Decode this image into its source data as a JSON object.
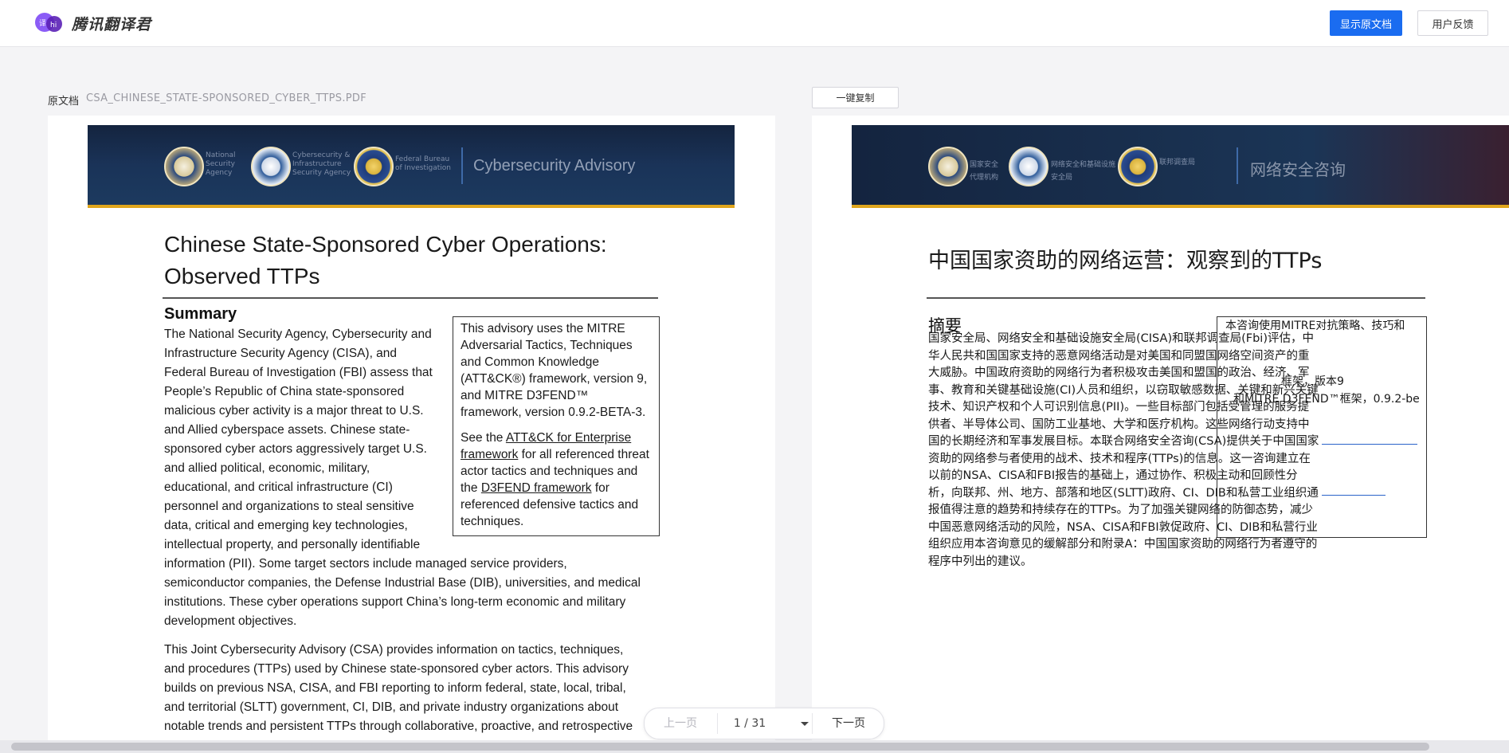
{
  "app": {
    "logo_badge": "hi",
    "logo_text": "腾讯翻译君"
  },
  "header": {
    "show_original_label": "显示原文档",
    "feedback_label": "用户反馈"
  },
  "file_bar": {
    "label": "原文档",
    "file_name": "CSA_CHINESE_STATE-SPONSORED_CYBER_TTPS.PDF",
    "copy_all_label": "一键复制"
  },
  "original": {
    "banner": {
      "agency1": "National\nSecurity\nAgency",
      "agency2": "Cybersecurity &\nInfrastructure\nSecurity Agency",
      "agency3": "Federal Bureau\nof Investigation",
      "title": "Cybersecurity Advisory"
    },
    "title": "Chinese State-Sponsored Cyber Operations: Observed TTPs",
    "summary_heading": "Summary",
    "para1_lines": [
      "The National Security Agency, Cybersecurity and",
      "Infrastructure Security Agency (CISA), and",
      "Federal Bureau of Investigation (FBI) assess that",
      "People’s Republic of China state-sponsored",
      "malicious cyber activity is a major threat to U.S.",
      "and Allied cyberspace assets. Chinese state-",
      "sponsored cyber actors aggressively target U.S.",
      "and allied political, economic, military,",
      "educational, and critical infrastructure (CI)",
      "personnel and organizations to steal sensitive",
      "data, critical and emerging key technologies,",
      "intellectual property, and personally identifiable",
      "information (PII). Some target sectors include managed service providers,",
      "semiconductor companies, the Defense Industrial Base (DIB), universities, and medical",
      "institutions. These cyber operations support China’s long-term economic and military",
      "development objectives."
    ],
    "para2_lines": [
      "This Joint Cybersecurity Advisory (CSA) provides information on tactics, techniques,",
      "and procedures (TTPs) used by Chinese state-sponsored cyber actors. This advisory",
      "builds on previous NSA, CISA, and FBI reporting to inform federal, state, local, tribal,",
      "and territorial (SLTT) government, CI, DIB, and private industry organizations about",
      "notable trends and persistent TTPs through collaborative, proactive, and retrospective"
    ],
    "sidebar": {
      "p1": "This advisory uses the MITRE Adversarial Tactics, Techniques and Common Knowledge (ATT&CK®) framework, version 9, and MITRE D3FEND™ framework, version 0.9.2-BETA-3.",
      "p2_pre": "See the ",
      "p2_link1": "ATT&CK for Enterprise framework",
      "p2_mid": " for all referenced threat actor tactics and techniques and the ",
      "p2_link2": "D3FEND framework",
      "p2_post": " for referenced defensive tactics and techniques."
    }
  },
  "translated": {
    "banner": {
      "agency1": "国家安全\n代理机构",
      "agency2": "网络安全和基础设施\n安全局",
      "agency3": "联邦调查局",
      "title": "网络安全咨询"
    },
    "title": "中国国家资助的网络运营：观察到的TTPs",
    "summary_heading": "摘要",
    "para_lines": [
      "国家安全局、网络安全和基础设施安全局(CISA)和联邦调查局(Fbi)评估，中",
      "华人民共和国国家支持的恶意网络活动是对美国和同盟国网络空间资产的重",
      "大威胁。中国政府资助的网络行为者积极攻击美国和盟国的政治、经济、军",
      "事、教育和关键基础设施(CI)人员和组织，以窃取敏感数据、关键和新兴关键",
      "技术、知识产权和个人可识别信息(PII)。一些目标部门包括受管理的服务提",
      "供者、半导体公司、国防工业基地、大学和医疗机构。这些网络行动支持中",
      "国的长期经济和军事发展目标。本联合网络安全咨询(CSA)提供关于中国国家",
      "资助的网络参与者使用的战术、技术和程序(TTPs)的信息。这一咨询建立在",
      "以前的NSA、CISA和FBI报告的基础上，通过协作、积极主动和回顾性分",
      "析，向联邦、州、地方、部落和地区(SLTT)政府、CI、DIB和私营工业组织通",
      "报值得注意的趋势和持续存在的TTPs。为了加强关键网络的防御态势，减少",
      "中国恶意网络活动的风险，NSA、CISA和FBI敦促政府、CI、DIB和私营行业",
      "组织应用本咨询意见的缓解部分和附录A：中国国家资助的网络行为者遵守的",
      "程序中列出的建议。"
    ],
    "box_line1": "本咨询使用MITRE对抗策略、技巧和",
    "box_line2": "框架，版本9",
    "box_line3": "和MITRE D3FEND™框架，0.9.2-be"
  },
  "pager": {
    "prev_label": "上一页",
    "page_display": "1 / 31",
    "next_label": "下一页"
  }
}
